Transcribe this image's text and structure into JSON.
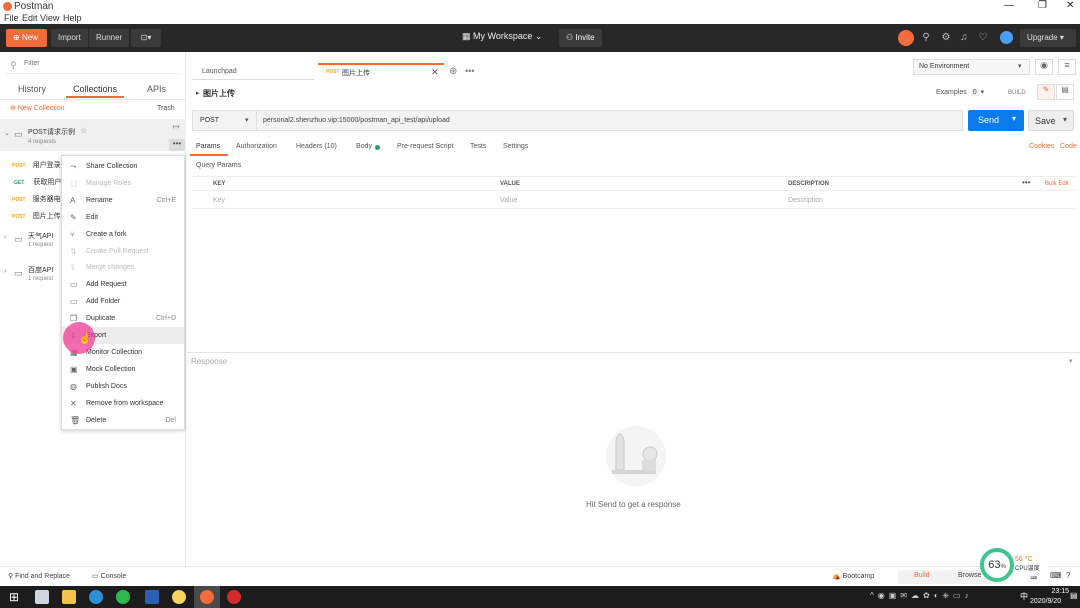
{
  "window": {
    "title": "Postman"
  },
  "menu": [
    "File",
    "Edit",
    "View",
    "Help"
  ],
  "header": {
    "new_label": "New",
    "import_label": "Import",
    "runner_label": "Runner",
    "workspace_label": "My Workspace",
    "invite_label": "Invite",
    "upgrade_label": "Upgrade"
  },
  "sidebar": {
    "filter_placeholder": "Filter",
    "tabs": [
      "History",
      "Collections",
      "APIs"
    ],
    "new_collection": "New Collection",
    "trash": "Trash",
    "collections": [
      {
        "name": "POST请求示例",
        "count": "4 requests"
      },
      {
        "name": "天气API",
        "count": "1 request"
      },
      {
        "name": "百度API",
        "count": "1 request"
      }
    ],
    "requests": [
      {
        "method": "POST",
        "name": "用户登录"
      },
      {
        "method": "GET",
        "name": "获取用户"
      },
      {
        "method": "POST",
        "name": "服务器电"
      },
      {
        "method": "POST",
        "name": "图片上传"
      }
    ]
  },
  "context_menu": [
    {
      "label": "Share Collection",
      "icon": "share-icon",
      "disabled": false,
      "shortcut": ""
    },
    {
      "label": "Manage Roles",
      "icon": "roles-icon",
      "disabled": true,
      "shortcut": ""
    },
    {
      "label": "Rename",
      "icon": "rename-icon",
      "disabled": false,
      "shortcut": "Ctrl+E"
    },
    {
      "label": "Edit",
      "icon": "edit-icon",
      "disabled": false,
      "shortcut": ""
    },
    {
      "label": "Create a fork",
      "icon": "fork-icon",
      "disabled": false,
      "shortcut": ""
    },
    {
      "label": "Create Pull Request",
      "icon": "pull-request-icon",
      "disabled": true,
      "shortcut": ""
    },
    {
      "label": "Merge changes",
      "icon": "merge-icon",
      "disabled": true,
      "shortcut": ""
    },
    {
      "label": "Add Request",
      "icon": "add-request-icon",
      "disabled": false,
      "shortcut": ""
    },
    {
      "label": "Add Folder",
      "icon": "folder-icon",
      "disabled": false,
      "shortcut": ""
    },
    {
      "label": "Duplicate",
      "icon": "duplicate-icon",
      "disabled": false,
      "shortcut": "Ctrl+D"
    },
    {
      "label": "Export",
      "icon": "export-icon",
      "disabled": false,
      "shortcut": ""
    },
    {
      "label": "Monitor Collection",
      "icon": "monitor-icon",
      "disabled": false,
      "shortcut": ""
    },
    {
      "label": "Mock Collection",
      "icon": "mock-icon",
      "disabled": false,
      "shortcut": ""
    },
    {
      "label": "Publish Docs",
      "icon": "docs-icon",
      "disabled": false,
      "shortcut": ""
    },
    {
      "label": "Remove from workspace",
      "icon": "close-icon",
      "disabled": false,
      "shortcut": ""
    },
    {
      "label": "Delete",
      "icon": "trash-icon",
      "disabled": false,
      "shortcut": "Del"
    }
  ],
  "tabs": [
    {
      "label": "Launchpad"
    },
    {
      "method": "POST",
      "label": "图片上传"
    }
  ],
  "environment": "No Environment",
  "request": {
    "title": "图片上传",
    "examples_label": "Examples",
    "examples_count": "0",
    "build_label": "BUILD",
    "method": "POST",
    "url": "personal2.shenzhuo.vip:15000/postman_api_test/api/upload",
    "send_label": "Send",
    "save_label": "Save",
    "subtabs": [
      "Params",
      "Authorization",
      "Headers (10)",
      "Body",
      "Pre-request Script",
      "Tests",
      "Settings"
    ],
    "cookies_label": "Cookies",
    "code_label": "Code",
    "query_params_label": "Query Params",
    "columns": [
      "KEY",
      "VALUE",
      "DESCRIPTION"
    ],
    "bulk_edit": "Bulk Edit",
    "key_placeholder": "Key",
    "value_placeholder": "Value",
    "desc_placeholder": "Description"
  },
  "response": {
    "label": "Response",
    "empty_text": "Hit Send to get a response"
  },
  "bottom": {
    "find_replace": "Find and Replace",
    "console": "Console",
    "bootcamp": "Bootcamp",
    "build": "Build",
    "browse": "Browse"
  },
  "cpu_widget": {
    "percent": "63",
    "percent_unit": "%",
    "temp": "56 °C",
    "label": "CPU温度"
  },
  "taskbar": {
    "time": "23:15",
    "date": "2020/9/20",
    "ime": "中"
  },
  "colors": {
    "accent": "#f26b3a",
    "send": "#097bed",
    "header": "#282828"
  }
}
